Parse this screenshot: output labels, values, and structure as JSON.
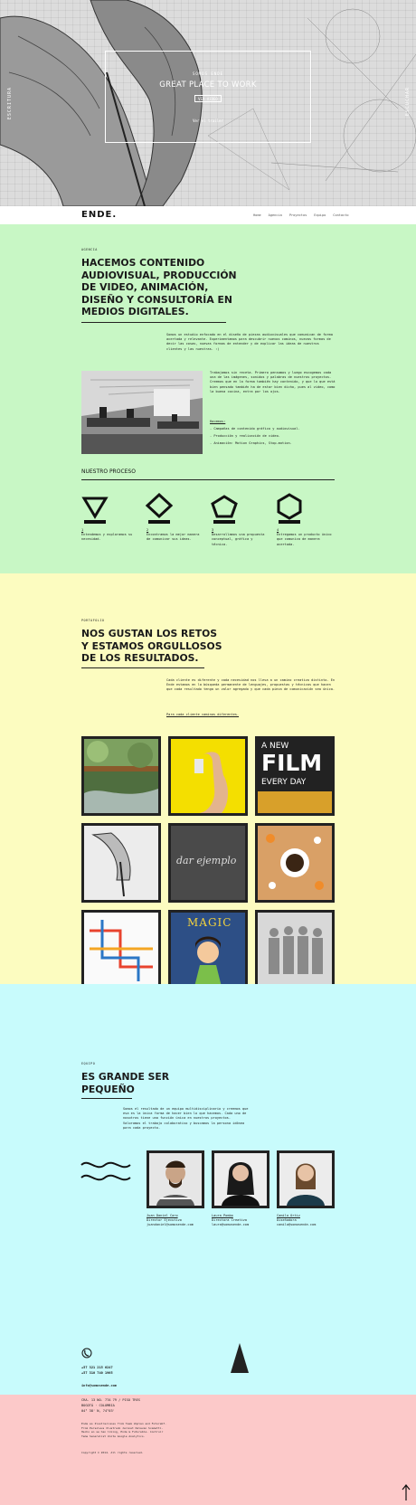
{
  "hero": {
    "side_left": "ESCRITURA",
    "side_right": "ESCUCHAR",
    "kicker": "SOMOS ENDE",
    "title": "GREAT PLACE TO WORK",
    "button": "VER VIDEO",
    "subtitle": "Ver el trailer"
  },
  "nav": {
    "logo": "ENDE.",
    "links": [
      "Home",
      "Agencia",
      "Proyectos",
      "Equipo",
      "Contacto"
    ]
  },
  "agency": {
    "kicker": "AGENCIA",
    "title_lines": [
      "HACEMOS CONTENIDO",
      "AUDIOVISUAL, PRODUCCIÓN",
      "DE VIDEO, ANIMACIÓN,",
      "DISEÑO Y CONSULTORÍA EN",
      "MEDIOS DIGITALES."
    ],
    "intro": "Somos un estudio enfocado en el diseño de piezas audiovisuales que comunican de forma acertada y relevante. Experimentamos para descubrir nuevos caminos, nuevas formas de decir las cosas, nuevas formas de entender y de explicar las ideas de nuestros clientes y las nuestras. :)",
    "body": "Trabajamos sin receta. Primero pensamos y luego escogemos cada una de las imágenes, sonidos y palabras de nuestros proyectos. Creemos que en la forma también hay contenido, y que lo que está bien pensado también ha de estar bien dicho, pues al video, como la buena cocina, entra por los ojos.",
    "services_title": "Hacemos:",
    "services": [
      "- Campañas de contenido gráfico y audiovisual.",
      "- Producción y realización de video.",
      "- Animación: Motion Graphics, Stop-motion."
    ],
    "process_title": "NUESTRO PROCESO",
    "steps": [
      {
        "num": "1",
        "text": "Entendemos y exploramos su necesidad."
      },
      {
        "num": "2",
        "text": "Encontramos la mejor manera de comunicar sus ideas."
      },
      {
        "num": "3",
        "text": "Desarrollamos una propuesta conceptual, gráfica y técnica."
      },
      {
        "num": "4",
        "text": "Entregamos un producto único que comunica de manera acertada."
      }
    ]
  },
  "portfolio": {
    "kicker": "PORTAFOLIO",
    "title_lines": [
      "NOS GUSTAN LOS RETOS",
      "Y ESTAMOS ORGULLOSOS",
      "DE LOS RESULTADOS."
    ],
    "intro": "Cada cliente es diferente y cada necesidad nos lleva a un camino creativo distinto. En Ende estamos en la búsqueda permanente de lenguajes, propuestas y técnicas que hacen que cada resultado tenga un valor agregado y que cada pieza de comunicación sea única.",
    "link": "Para cada cliente caminos diferentes.",
    "film_tile": [
      "A NEW",
      "FILM",
      "EVERY DAY"
    ],
    "chalk_text": "dar ejemplo",
    "magic_text": "MAGIC"
  },
  "team": {
    "kicker": "EQUIPO",
    "title_lines": [
      "ES GRANDE SER",
      "PEQUEÑO"
    ],
    "intro": "Somos el resultado de un equipo multidisciplinario y creemos que esa es la única forma de hacer bien lo que hacemos. Cada uno de nosotros tiene una función única en nuestros proyectos. Valoramos el trabajo colaborativo y buscamos la persona idónea para cada proyecto.",
    "members": [
      {
        "name": "Juan Daniel Caro",
        "role": "Director Ejecutivo",
        "email": "juandaniel@somosende.com"
      },
      {
        "name": "Laura Pombo",
        "role": "Directora Creativa",
        "email": "laura@somosende.com"
      },
      {
        "name": "Camila Ortiz",
        "role": "Diseñadora",
        "email": "camila@somosende.com"
      }
    ]
  },
  "contact": {
    "phone1": "+57 321 215 6247",
    "phone2": "+57 310 740 1965",
    "email": "info@somosende.com"
  },
  "footer": {
    "address1": "CRA. 13 NO. 77A 79 / PISO TRES",
    "address2": "BOGOTÁ · COLOMBIA",
    "coords": "04° 38' N, 74°03'",
    "note": "Ende es Ilustraciones from Team Unplan and Futurebf. From Persoleus Ilustrado Jeronet Dalavan Scametti. Hecho en se han liking, Ende & Futureble. Contruir Teme Seneralist Unite Google Analytics.",
    "copyright": "Copyright © 2014. All rights reserved."
  }
}
